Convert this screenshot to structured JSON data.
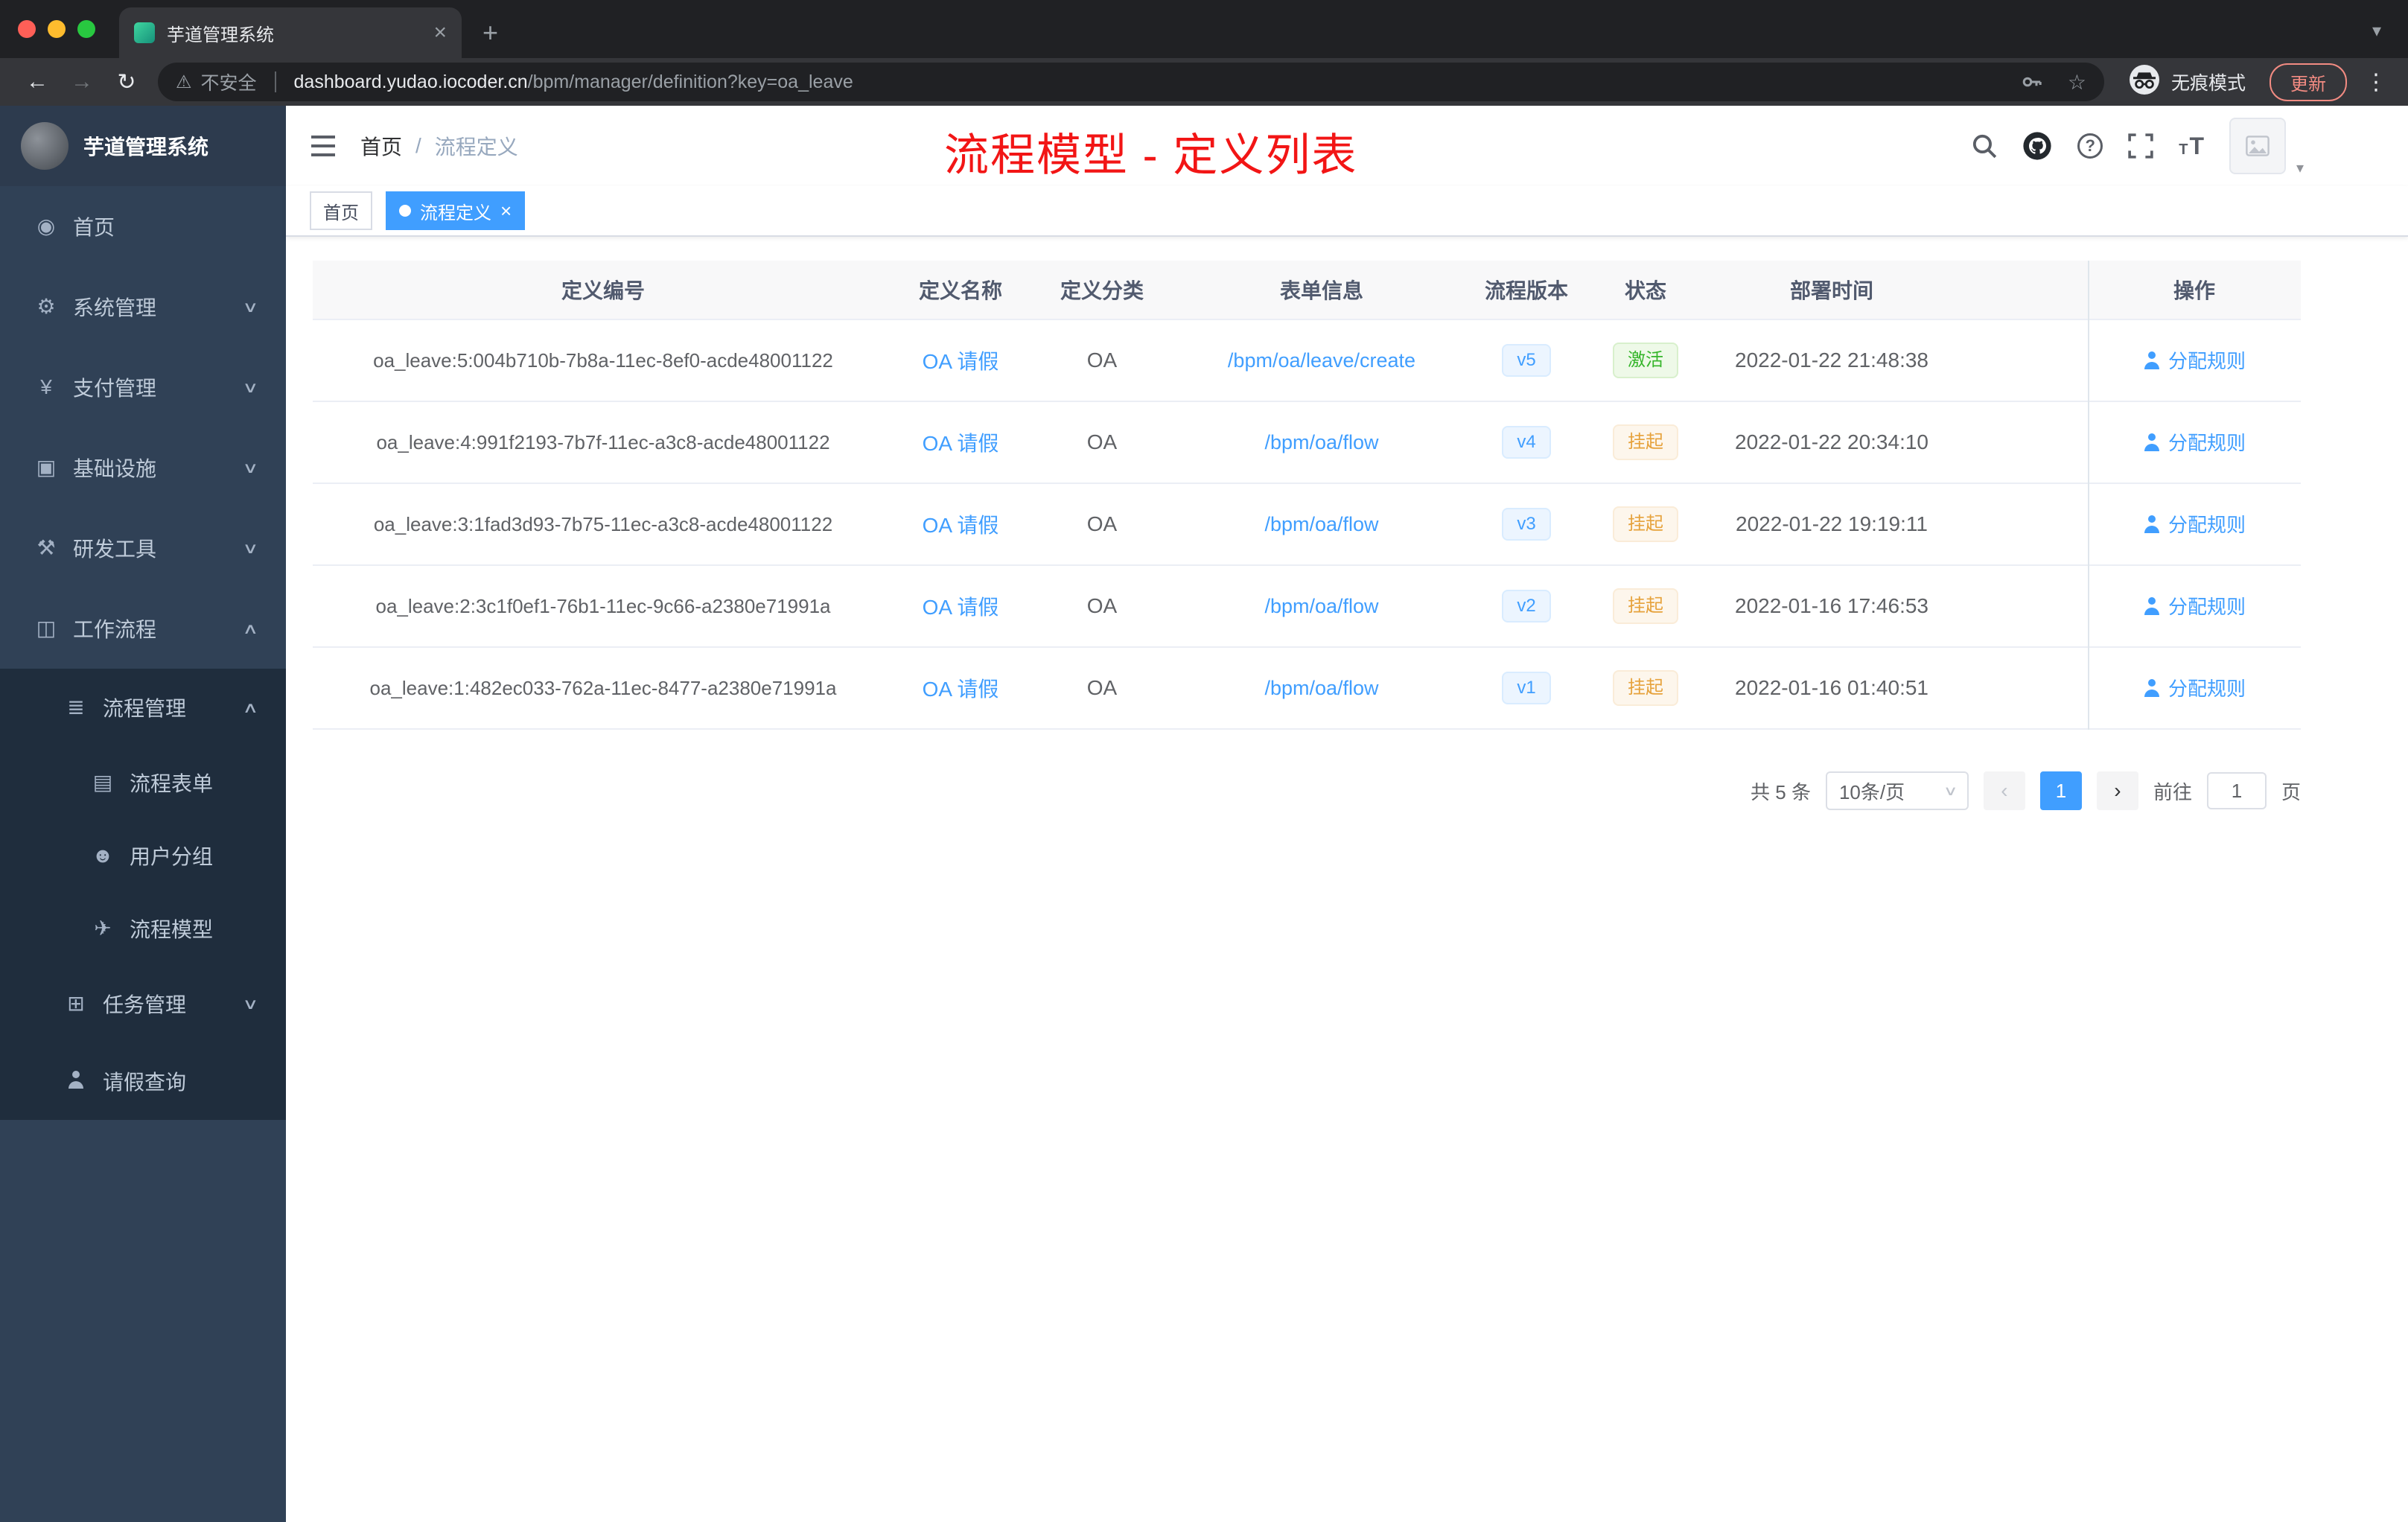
{
  "browser": {
    "tab_title": "芋道管理系统",
    "security_label": "不安全",
    "url_host": "dashboard.yudao.iocoder.cn",
    "url_path": "/bpm/manager/definition?key=oa_leave",
    "incognito_label": "无痕模式",
    "update_label": "更新"
  },
  "icons": {
    "back": "←",
    "forward": "→",
    "reload": "↻",
    "warning": "⚠",
    "star": "☆",
    "close": "×",
    "new_tab": "+",
    "tab_list_caret": "▾",
    "menu_dots": "⋮",
    "chevron_down": "∨",
    "chevron_up": "∧",
    "question": "?",
    "font_size": "T",
    "breadcrumb_separator": "/",
    "avatar_caret": "▾",
    "prev": "‹",
    "next": "›"
  },
  "colors": {
    "accent_blue": "#409eff",
    "status_success": "#35b52a",
    "status_warning": "#e6a23c",
    "annotation_red": "#f21515",
    "sidebar_bg": "#304156",
    "submenu_bg": "#1f2d3d"
  },
  "sidebar": {
    "logo_title": "芋道管理系统",
    "menu": [
      {
        "label": "首页",
        "glyph": "◉"
      },
      {
        "label": "系统管理",
        "glyph": "⚙"
      },
      {
        "label": "支付管理",
        "glyph": "¥"
      },
      {
        "label": "基础设施",
        "glyph": "▣"
      },
      {
        "label": "研发工具",
        "glyph": "⚒"
      },
      {
        "label": "工作流程",
        "glyph": "◫"
      },
      {
        "label": "流程管理",
        "glyph": "≣"
      },
      {
        "label": "流程表单",
        "glyph": "▤"
      },
      {
        "label": "用户分组",
        "glyph": "☻"
      },
      {
        "label": "流程模型",
        "glyph": "✈"
      },
      {
        "label": "任务管理",
        "glyph": "⊞"
      },
      {
        "label": "请假查询",
        "glyph": ""
      }
    ]
  },
  "header": {
    "breadcrumb_home": "首页",
    "breadcrumb_current": "流程定义",
    "annotation": "流程模型 - 定义列表"
  },
  "tags": {
    "home": "首页",
    "active": "流程定义"
  },
  "table": {
    "columns": {
      "id": "定义编号",
      "name": "定义名称",
      "category": "定义分类",
      "form": "表单信息",
      "version": "流程版本",
      "status": "状态",
      "deploy_time": "部署时间",
      "action": "操作"
    },
    "rows": [
      {
        "id": "oa_leave:5:004b710b-7b8a-11ec-8ef0-acde48001122",
        "name": "OA 请假",
        "category": "OA",
        "form": "/bpm/oa/leave/create",
        "version": "v5",
        "status": "激活",
        "status_type": "success",
        "deploy_time": "2022-01-22 21:48:38",
        "action": "分配规则"
      },
      {
        "id": "oa_leave:4:991f2193-7b7f-11ec-a3c8-acde48001122",
        "name": "OA 请假",
        "category": "OA",
        "form": "/bpm/oa/flow",
        "version": "v4",
        "status": "挂起",
        "status_type": "warning",
        "deploy_time": "2022-01-22 20:34:10",
        "action": "分配规则"
      },
      {
        "id": "oa_leave:3:1fad3d93-7b75-11ec-a3c8-acde48001122",
        "name": "OA 请假",
        "category": "OA",
        "form": "/bpm/oa/flow",
        "version": "v3",
        "status": "挂起",
        "status_type": "warning",
        "deploy_time": "2022-01-22 19:19:11",
        "action": "分配规则"
      },
      {
        "id": "oa_leave:2:3c1f0ef1-76b1-11ec-9c66-a2380e71991a",
        "name": "OA 请假",
        "category": "OA",
        "form": "/bpm/oa/flow",
        "version": "v2",
        "status": "挂起",
        "status_type": "warning",
        "deploy_time": "2022-01-16 17:46:53",
        "action": "分配规则"
      },
      {
        "id": "oa_leave:1:482ec033-762a-11ec-8477-a2380e71991a",
        "name": "OA 请假",
        "category": "OA",
        "form": "/bpm/oa/flow",
        "version": "v1",
        "status": "挂起",
        "status_type": "warning",
        "deploy_time": "2022-01-16 01:40:51",
        "action": "分配规则"
      }
    ]
  },
  "pagination": {
    "total": "共 5 条",
    "page_size": "10条/页",
    "current_page": "1",
    "goto_label": "前往",
    "goto_value": "1",
    "page_unit": "页"
  }
}
